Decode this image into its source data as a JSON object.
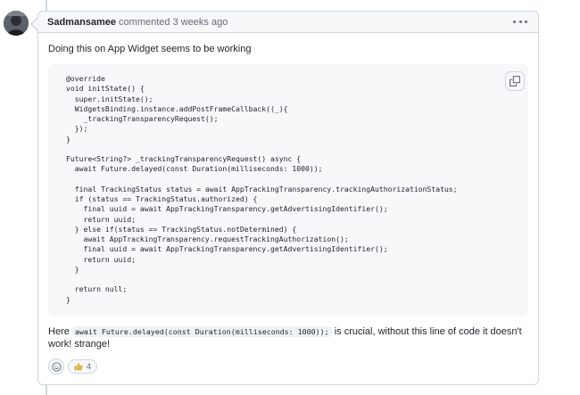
{
  "comment": {
    "author": "Sadmansamee",
    "meta": "commented 3 weeks ago",
    "intro": "Doing this on App Widget seems to be working",
    "code": "@override\nvoid initState() {\n  super.initState();\n  WidgetsBinding.instance.addPostFrameCallback((_){\n    _trackingTransparencyRequest();\n  });\n}\n\nFuture<String?> _trackingTransparencyRequest() async {\n  await Future.delayed(const Duration(milliseconds: 1000));\n\n  final TrackingStatus status = await AppTrackingTransparency.trackingAuthorizationStatus;\n  if (status == TrackingStatus.authorized) {\n    final uuid = await AppTrackingTransparency.getAdvertisingIdentifier();\n    return uuid;\n  } else if(status == TrackingStatus.notDetermined) {\n    await AppTrackingTransparency.requestTrackingAuthorization();\n    final uuid = await AppTrackingTransparency.getAdvertisingIdentifier();\n    return uuid;\n  }\n\n  return null;\n}",
    "after_prefix": "Here",
    "after_code": "await Future.delayed(const Duration(milliseconds: 1000));",
    "after_suffix": "is crucial, without this line of code it doesn't work! strange!",
    "reactions": {
      "add_icon": "smiley-icon",
      "thumbs_up_icon": "thumbs-up-icon",
      "thumbs_up_count": "4"
    }
  },
  "icons": {
    "menu": "kebab-horizontal-icon",
    "copy": "copy-icon"
  },
  "colors": {
    "border": "#d0d7de",
    "header_bg": "#f6f8fa",
    "muted_text": "#656d76",
    "text": "#1f2328"
  }
}
